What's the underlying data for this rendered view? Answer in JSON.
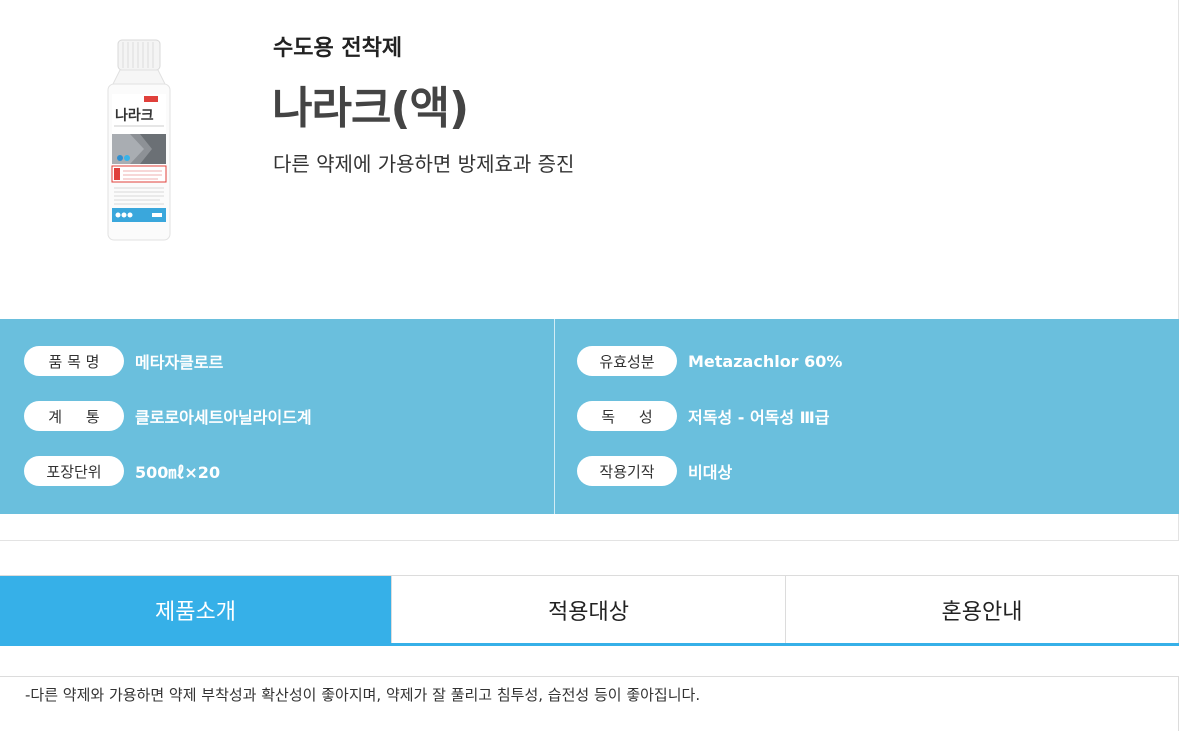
{
  "product": {
    "category": "수도용 전착제",
    "name": "나라크(액)",
    "tagline": "다른 약제에 가용하면 방제효과 증진",
    "image_label": "나라크"
  },
  "specs": {
    "left": [
      {
        "label": "품 목 명",
        "value": "메타자클로르"
      },
      {
        "label": "계     통",
        "value": "클로로아세트아닐라이드계"
      },
      {
        "label": "포장단위",
        "value": "500㎖×20"
      }
    ],
    "right": [
      {
        "label": "유효성분",
        "value": "Metazachlor 60%"
      },
      {
        "label": "독     성",
        "value": "저독성 - 어독성 Ⅲ급"
      },
      {
        "label": "작용기작",
        "value": "비대상"
      }
    ]
  },
  "tabs": [
    {
      "label": "제품소개",
      "active": true
    },
    {
      "label": "적용대상",
      "active": false
    },
    {
      "label": "혼용안내",
      "active": false
    }
  ],
  "description": "-다른 약제와 가용하면 약제 부착성과 확산성이 좋아지며, 약제가 잘 풀리고 침투성, 습전성 등이 좋아집니다.",
  "colors": {
    "spec_band": "#6abfdd",
    "tab_active": "#36b0e8"
  }
}
